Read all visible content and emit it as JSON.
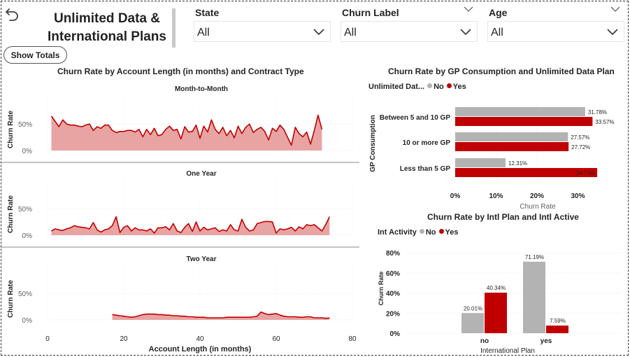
{
  "header": {
    "title_line1": "Unlimited Data &",
    "title_line2": "International  Plans",
    "show_totals_label": "Show Totals"
  },
  "filters": [
    {
      "label": "State",
      "value": "All"
    },
    {
      "label": "Churn Label",
      "value": "All"
    },
    {
      "label": "Age",
      "value": "All"
    }
  ],
  "colors": {
    "red": "#c00000",
    "red_fill": "#e8a3a3",
    "grey": "#b3b3b3",
    "text": "#252423"
  },
  "chart_data": [
    {
      "type": "area",
      "title": "Churn Rate by Account Length (in months) and Contract Type",
      "xlabel": "Account Length (in months)",
      "ylabel": "Churn Rate",
      "x_ticks": [
        "0",
        "20",
        "40",
        "60",
        "80"
      ],
      "y_ticks": [
        "0%",
        "50%"
      ],
      "xlim": [
        0,
        80
      ],
      "ylim": [
        0,
        0.9
      ],
      "panels": [
        {
          "name": "Month-to-Month",
          "x": [
            1,
            2,
            3,
            4,
            5,
            6,
            7,
            8,
            9,
            10,
            11,
            12,
            13,
            14,
            15,
            16,
            17,
            18,
            19,
            20,
            21,
            22,
            23,
            24,
            25,
            26,
            27,
            28,
            29,
            30,
            31,
            32,
            33,
            34,
            35,
            36,
            37,
            38,
            39,
            40,
            41,
            42,
            43,
            44,
            45,
            46,
            47,
            48,
            49,
            50,
            51,
            52,
            53,
            54,
            55,
            56,
            57,
            58,
            59,
            60,
            61,
            62,
            63,
            64,
            65,
            66,
            67,
            68,
            69,
            70,
            71,
            72
          ],
          "y": [
            0.65,
            0.55,
            0.45,
            0.58,
            0.5,
            0.48,
            0.48,
            0.46,
            0.45,
            0.48,
            0.5,
            0.38,
            0.45,
            0.42,
            0.48,
            0.48,
            0.38,
            0.34,
            0.36,
            0.36,
            0.38,
            0.38,
            0.35,
            0.4,
            0.26,
            0.4,
            0.3,
            0.42,
            0.28,
            0.3,
            0.4,
            0.46,
            0.38,
            0.4,
            0.22,
            0.45,
            0.35,
            0.36,
            0.48,
            0.23,
            0.46,
            0.35,
            0.58,
            0.4,
            0.32,
            0.44,
            0.28,
            0.38,
            0.24,
            0.46,
            0.32,
            0.44,
            0.5,
            0.34,
            0.4,
            0.44,
            0.36,
            0.2,
            0.42,
            0.36,
            0.48,
            0.4,
            0.25,
            0.1,
            0.44,
            0.32,
            0.26,
            0.35,
            0.12,
            0.38,
            0.67,
            0.4
          ]
        },
        {
          "name": "One Year",
          "x": [
            1,
            2,
            3,
            4,
            5,
            6,
            7,
            8,
            9,
            10,
            11,
            12,
            13,
            14,
            15,
            16,
            17,
            18,
            19,
            20,
            21,
            22,
            23,
            24,
            25,
            26,
            27,
            28,
            29,
            30,
            31,
            32,
            33,
            34,
            35,
            36,
            37,
            38,
            39,
            40,
            41,
            42,
            43,
            44,
            45,
            46,
            47,
            48,
            49,
            50,
            51,
            52,
            53,
            54,
            55,
            56,
            57,
            58,
            59,
            60,
            61,
            62,
            63,
            64,
            65,
            66,
            67,
            68,
            69,
            70,
            71,
            72,
            73,
            74
          ],
          "y": [
            0.08,
            0.12,
            0.1,
            0.09,
            0.12,
            0.14,
            0.18,
            0.16,
            0.15,
            0.14,
            0.12,
            0.24,
            0.1,
            0.06,
            0.1,
            0.12,
            0.18,
            0.35,
            0.05,
            0.15,
            0.18,
            0.08,
            0.14,
            0.1,
            0.1,
            0.08,
            0.12,
            0.04,
            0.14,
            0.14,
            0.16,
            0.1,
            0.22,
            0.08,
            0.05,
            0.15,
            0.22,
            0.07,
            0.25,
            0.08,
            0.15,
            0.1,
            0.12,
            0.14,
            0.07,
            0.1,
            0.08,
            0.2,
            0.1,
            0.08,
            0.3,
            0.15,
            0.08,
            0.1,
            0.22,
            0.24,
            0.26,
            0.26,
            0.25,
            0.04,
            0.12,
            0.1,
            0.12,
            0.15,
            0.08,
            0.16,
            0.12,
            0.2,
            0.18,
            0.2,
            0.14,
            0.08,
            0.2,
            0.35
          ]
        },
        {
          "name": "Two Year",
          "x": [
            17,
            18,
            19,
            20,
            21,
            22,
            23,
            24,
            25,
            26,
            27,
            28,
            29,
            30,
            31,
            32,
            33,
            34,
            35,
            36,
            37,
            38,
            39,
            40,
            41,
            42,
            43,
            44,
            45,
            46,
            47,
            48,
            49,
            50,
            51,
            52,
            53,
            54,
            55,
            56,
            57,
            58,
            59,
            60,
            61,
            62,
            63,
            64,
            65,
            66,
            67,
            68,
            69,
            70,
            71,
            72,
            73,
            74
          ],
          "y": [
            0.1,
            0.09,
            0.08,
            0.07,
            0.06,
            0.05,
            0.06,
            0.08,
            0.1,
            0.11,
            0.11,
            0.11,
            0.1,
            0.1,
            0.09,
            0.09,
            0.08,
            0.08,
            0.07,
            0.07,
            0.06,
            0.06,
            0.05,
            0.05,
            0.05,
            0.04,
            0.04,
            0.04,
            0.04,
            0.04,
            0.05,
            0.05,
            0.05,
            0.05,
            0.05,
            0.05,
            0.05,
            0.06,
            0.07,
            0.15,
            0.12,
            0.1,
            0.11,
            0.12,
            0.09,
            0.07,
            0.06,
            0.06,
            0.06,
            0.05,
            0.05,
            0.06,
            0.06,
            0.04,
            0.04,
            0.04,
            0.03,
            0.04
          ]
        }
      ]
    },
    {
      "type": "bar",
      "orientation": "horizontal",
      "title": "Churn Rate by GP Consumption and Unlimited Data Plan",
      "legend_title": "Unlimited Dat...",
      "xlabel": "Churn Rate",
      "ylabel": "GP Consumption",
      "x_ticks": [
        "0%",
        "10%",
        "20%",
        "30%"
      ],
      "xlim": [
        0,
        0.4
      ],
      "categories": [
        "Between 5 and 10 GP",
        "10 or more GP",
        "Less than 5 GP"
      ],
      "series": [
        {
          "name": "No",
          "color": "#b3b3b3",
          "values": [
            0.3178,
            0.2757,
            0.1231
          ],
          "labels": [
            "31.78%",
            "27.57%",
            "12.31%"
          ]
        },
        {
          "name": "Yes",
          "color": "#c00000",
          "values": [
            0.3357,
            0.2772,
            0.3471
          ],
          "labels": [
            "33.57%",
            "27.72%",
            "34.71%"
          ]
        }
      ]
    },
    {
      "type": "bar",
      "orientation": "vertical",
      "title": "Churn Rate by Intl Plan and Intl Active",
      "legend_title": "Int Activity",
      "xlabel": "International Plan",
      "ylabel": "Churn Rate",
      "y_ticks": [
        "0%",
        "20%",
        "40%",
        "60%",
        "80%"
      ],
      "ylim": [
        0,
        0.8
      ],
      "categories": [
        "no",
        "yes"
      ],
      "series": [
        {
          "name": "No",
          "color": "#b3b3b3",
          "values": [
            0.2001,
            0.7119
          ],
          "labels": [
            "20.01%",
            "71.19%"
          ]
        },
        {
          "name": "Yes",
          "color": "#c00000",
          "values": [
            0.4034,
            0.0759
          ],
          "labels": [
            "40.34%",
            "7.59%"
          ]
        }
      ]
    }
  ]
}
